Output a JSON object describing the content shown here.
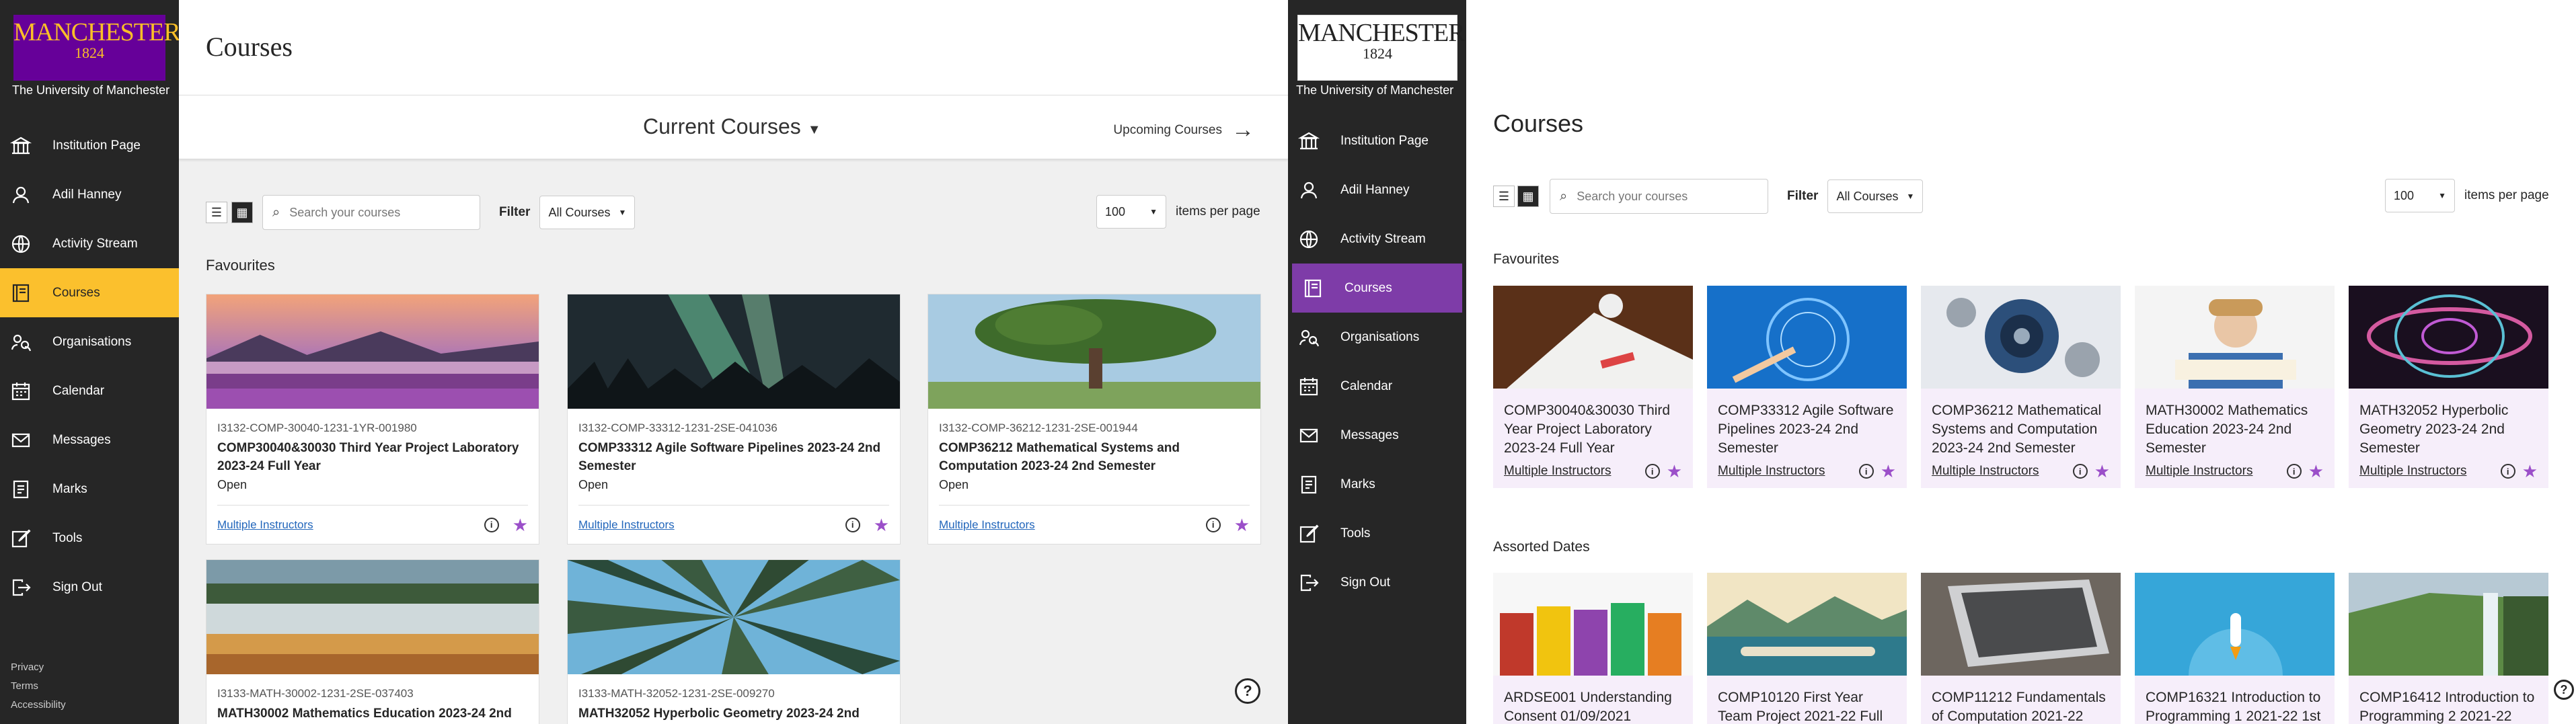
{
  "university": {
    "wordmark": "MANCHESTER",
    "year": "1824",
    "name": "The University of Manchester"
  },
  "nav": [
    {
      "label": "Institution Page",
      "icon": "institution-icon"
    },
    {
      "label": "Adil Hanney",
      "icon": "user-icon"
    },
    {
      "label": "Activity Stream",
      "icon": "globe-icon"
    },
    {
      "label": "Courses",
      "icon": "courses-icon"
    },
    {
      "label": "Organisations",
      "icon": "organisations-icon"
    },
    {
      "label": "Calendar",
      "icon": "calendar-icon"
    },
    {
      "label": "Messages",
      "icon": "envelope-icon"
    },
    {
      "label": "Marks",
      "icon": "marks-icon"
    },
    {
      "label": "Tools",
      "icon": "tools-icon"
    },
    {
      "label": "Sign Out",
      "icon": "sign-out-icon"
    }
  ],
  "footer": [
    "Privacy",
    "Terms",
    "Accessibility"
  ],
  "left": {
    "title": "Courses",
    "current": "Current Courses",
    "upcoming": "Upcoming Courses",
    "search_placeholder": "Search your courses",
    "filter_label": "Filter",
    "filter_value": "All Courses",
    "per_page": "100",
    "per_page_label": "items per page",
    "favourites": "Favourites",
    "accent": "#fbc02d",
    "cards": [
      {
        "id": "I3132-COMP-30040-1231-1YR-001980",
        "name": "COMP30040&30030 Third Year Project Laboratory 2023-24 Full Year",
        "status": "Open",
        "instructors": "Multiple Instructors"
      },
      {
        "id": "I3132-COMP-33312-1231-2SE-041036",
        "name": "COMP33312 Agile Software Pipelines 2023-24 2nd Semester",
        "status": "Open",
        "instructors": "Multiple Instructors"
      },
      {
        "id": "I3132-COMP-36212-1231-2SE-001944",
        "name": "COMP36212 Mathematical Systems and Computation 2023-24 2nd Semester",
        "status": "Open",
        "instructors": "Multiple Instructors"
      },
      {
        "id": "I3133-MATH-30002-1231-2SE-037403",
        "name": "MATH30002 Mathematics Education 2023-24 2nd"
      },
      {
        "id": "I3133-MATH-32052-1231-2SE-009270",
        "name": "MATH32052 Hyperbolic Geometry 2023-24 2nd"
      }
    ]
  },
  "right": {
    "title": "Courses",
    "search_placeholder": "Search your courses",
    "filter_label": "Filter",
    "filter_value": "All Courses",
    "per_page": "100",
    "per_page_label": "items per page",
    "favourites": "Favourites",
    "assorted": "Assorted Dates",
    "accent": "#7e3ca8",
    "fav_cards": [
      {
        "name": "COMP30040&30030 Third Year Project Laboratory 2023-24 Full Year",
        "instructors": "Multiple Instructors"
      },
      {
        "name": "COMP33312 Agile Software Pipelines 2023-24 2nd Semester",
        "instructors": "Multiple Instructors"
      },
      {
        "name": "COMP36212 Mathematical Systems and Computation 2023-24 2nd Semester",
        "instructors": "Multiple Instructors"
      },
      {
        "name": "MATH30002 Mathematics Education 2023-24 2nd Semester",
        "instructors": "Multiple Instructors"
      },
      {
        "name": "MATH32052 Hyperbolic Geometry 2023-24 2nd Semester",
        "instructors": "Multiple Instructors"
      }
    ],
    "assorted_cards": [
      {
        "name": "ARDSE001 Understanding Consent 01/09/2021"
      },
      {
        "name": "COMP10120 First Year Team Project 2021-22 Full"
      },
      {
        "name": "COMP11212 Fundamentals of Computation 2021-22"
      },
      {
        "name": "COMP16321 Introduction to Programming 1 2021-22 1st"
      },
      {
        "name": "COMP16412 Introduction to Programming 2 2021-22"
      }
    ]
  }
}
